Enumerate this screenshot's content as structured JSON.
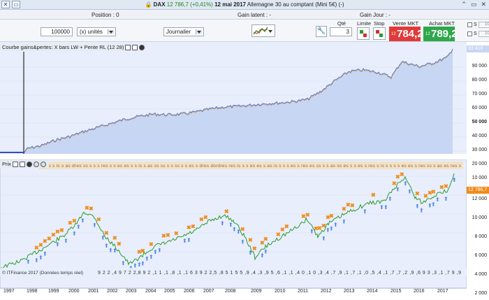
{
  "titlebar": {
    "instrument": "DAX",
    "price": "12 786,7",
    "change": "(+0,41%)",
    "date": "12 mai 2017",
    "description": "Allemagne 30 au comptant (Mini 5€) (-)",
    "controls": [
      "⌃",
      "▭",
      "✕"
    ]
  },
  "infobar": {
    "position": "Position : 0",
    "gain_latent": "Gain latent : -",
    "gain_jour": "Gain Jour : -"
  },
  "toolbar": {
    "quantity_value": "100000",
    "unit_select": "(x) unités",
    "period_select": "Journalier"
  },
  "order_panel": {
    "qty_label": "Qté",
    "qty_value": "3",
    "limit_label": "Limite",
    "stop_label": "Stop",
    "sell_label": "Vente MKT",
    "sell_prefix": "12",
    "sell_price": "784,2",
    "buy_label": "Achat MKT",
    "buy_prefix": "12",
    "buy_price": "789,2",
    "checks": [
      {
        "label": "S",
        "value": "10"
      },
      {
        "label": "S",
        "value": "10"
      }
    ],
    "colors": {
      "sell": "#e23a3a",
      "buy": "#2ea84a"
    }
  },
  "equity_panel": {
    "title": "Courbe gains&pertes: X bars LW + Pente RL (12 28)",
    "scale_labels": [
      "90 000",
      "80 000",
      "70 000",
      "60 000",
      "50 000",
      "40 000",
      "30 000",
      "20 000",
      "10 000"
    ],
    "current_label": "93 410"
  },
  "price_panel": {
    "title": "Prix",
    "current_label": "12 786,7",
    "scale_labels": [
      "12 000",
      "10 000",
      "8 000",
      "6 000",
      "4 000",
      "2 000"
    ],
    "footer": "© ITFinance 2017 (Données temps réel)"
  },
  "x_axis": {
    "years": [
      "1997",
      "1998",
      "1999",
      "2000",
      "2001",
      "2002",
      "2003",
      "2004",
      "2005",
      "2006",
      "2007",
      "2008",
      "2009",
      "2010",
      "2011",
      "2012",
      "2013",
      "2014",
      "2015",
      "2016",
      "2017"
    ]
  },
  "colors": {
    "panel_bg": "#e8eefc",
    "fill": "#c7d6f3",
    "line": "#4a78d6",
    "accent": "#f08a1a",
    "signal_buy": "#4f86e8"
  }
}
